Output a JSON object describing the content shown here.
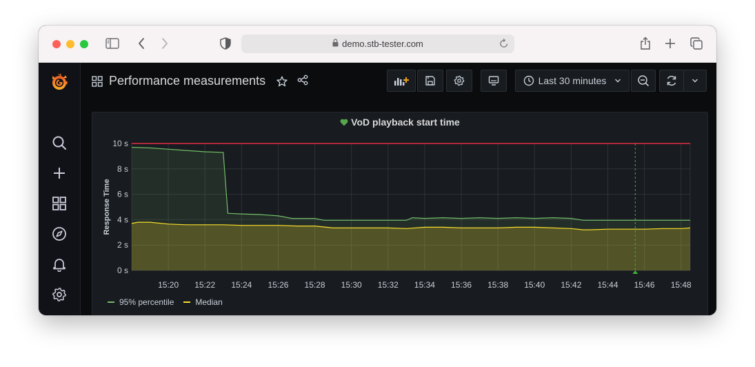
{
  "browser": {
    "url": "demo.stb-tester.com",
    "icons": [
      "sidebar-toggle-icon",
      "back-icon",
      "forward-icon",
      "shield-icon",
      "lock-icon",
      "reload-icon",
      "share-icon",
      "new-tab-icon",
      "tabs-icon"
    ]
  },
  "sidebar": {
    "items": [
      {
        "name": "grafana-logo",
        "icon": "grafana-logo"
      },
      {
        "name": "search",
        "icon": "search-icon"
      },
      {
        "name": "create",
        "icon": "plus-icon"
      },
      {
        "name": "dashboards",
        "icon": "dashboards-icon"
      },
      {
        "name": "explore",
        "icon": "compass-icon"
      },
      {
        "name": "alerting",
        "icon": "bell-icon"
      },
      {
        "name": "configuration",
        "icon": "gear-icon"
      }
    ]
  },
  "header": {
    "title": "Performance measurements",
    "time_range": "Last 30 minutes",
    "buttons": [
      "add-panel-icon",
      "save-icon",
      "settings-icon",
      "tv-mode-icon",
      "clock-icon",
      "zoom-out-icon",
      "refresh-icon",
      "chevron-down-icon"
    ]
  },
  "colors": {
    "p95": "#73bf69",
    "median": "#fade2a",
    "threshold": "#e02f44",
    "annotation": "#37872d",
    "health": "#56a64b"
  },
  "panel": {
    "title": "VoD playback start time"
  },
  "chart_data": {
    "type": "line",
    "title": "VoD playback start time",
    "ylabel": "Response Time",
    "xlabel": "",
    "ylim": [
      0,
      10
    ],
    "y_ticks": [
      "0 s",
      "2 s",
      "4 s",
      "6 s",
      "8 s",
      "10 s"
    ],
    "x_ticks": [
      "15:20",
      "15:22",
      "15:24",
      "15:26",
      "15:28",
      "15:30",
      "15:32",
      "15:34",
      "15:36",
      "15:38",
      "15:40",
      "15:42",
      "15:44",
      "15:46",
      "15:48"
    ],
    "x_range": [
      "15:18",
      "15:48:30"
    ],
    "grid": true,
    "legend_position": "bottom-left",
    "threshold": 10,
    "annotation_time": "15:45:30",
    "series": [
      {
        "name": "95% percentile",
        "fill": "area",
        "points": [
          [
            "15:18",
            9.7
          ],
          [
            "15:19",
            9.65
          ],
          [
            "15:20",
            9.55
          ],
          [
            "15:21",
            9.45
          ],
          [
            "15:22",
            9.35
          ],
          [
            "15:23",
            9.3
          ],
          [
            "15:23:15",
            4.5
          ],
          [
            "15:24",
            4.45
          ],
          [
            "15:25",
            4.4
          ],
          [
            "15:26",
            4.3
          ],
          [
            "15:26:45",
            4.1
          ],
          [
            "15:27",
            4.1
          ],
          [
            "15:28",
            4.1
          ],
          [
            "15:28:30",
            3.95
          ],
          [
            "15:30",
            3.95
          ],
          [
            "15:31",
            3.95
          ],
          [
            "15:32",
            3.95
          ],
          [
            "15:33",
            3.95
          ],
          [
            "15:33:20",
            4.15
          ],
          [
            "15:34",
            4.1
          ],
          [
            "15:35",
            4.15
          ],
          [
            "15:36",
            4.1
          ],
          [
            "15:37",
            4.15
          ],
          [
            "15:38",
            4.1
          ],
          [
            "15:39",
            4.15
          ],
          [
            "15:40",
            4.1
          ],
          [
            "15:41",
            4.15
          ],
          [
            "15:42",
            4.1
          ],
          [
            "15:42:40",
            3.95
          ],
          [
            "15:44",
            3.95
          ],
          [
            "15:46",
            3.95
          ],
          [
            "15:48",
            3.95
          ],
          [
            "15:48:30",
            3.95
          ]
        ]
      },
      {
        "name": "Median",
        "fill": "area",
        "points": [
          [
            "15:18",
            3.7
          ],
          [
            "15:18:20",
            3.8
          ],
          [
            "15:19",
            3.8
          ],
          [
            "15:20",
            3.65
          ],
          [
            "15:21",
            3.6
          ],
          [
            "15:22",
            3.6
          ],
          [
            "15:23",
            3.6
          ],
          [
            "15:24",
            3.55
          ],
          [
            "15:25",
            3.55
          ],
          [
            "15:26",
            3.55
          ],
          [
            "15:27",
            3.5
          ],
          [
            "15:28",
            3.5
          ],
          [
            "15:29",
            3.35
          ],
          [
            "15:30",
            3.35
          ],
          [
            "15:31",
            3.35
          ],
          [
            "15:32",
            3.35
          ],
          [
            "15:33",
            3.3
          ],
          [
            "15:34",
            3.4
          ],
          [
            "15:35",
            3.4
          ],
          [
            "15:36",
            3.35
          ],
          [
            "15:37",
            3.35
          ],
          [
            "15:38",
            3.35
          ],
          [
            "15:39",
            3.4
          ],
          [
            "15:40",
            3.4
          ],
          [
            "15:41",
            3.35
          ],
          [
            "15:42",
            3.3
          ],
          [
            "15:42:40",
            3.2
          ],
          [
            "15:43",
            3.2
          ],
          [
            "15:44",
            3.25
          ],
          [
            "15:45",
            3.25
          ],
          [
            "15:46",
            3.25
          ],
          [
            "15:47",
            3.3
          ],
          [
            "15:48",
            3.3
          ],
          [
            "15:48:30",
            3.35
          ]
        ]
      }
    ]
  }
}
